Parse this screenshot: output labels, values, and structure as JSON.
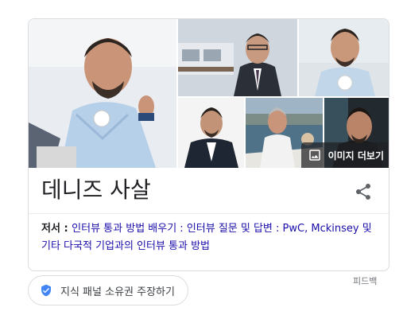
{
  "panel": {
    "title": "데니즈 사살",
    "more_images_label": "이미지 더보기",
    "description": {
      "label": "저서 : ",
      "link_text": "인터뷰 통과 방법 배우기 : 인터뷰 질문 및 답변 : PwC, Mckinsey 및 기타 다국적 기업과의 인터뷰 통과 방법"
    }
  },
  "footer": {
    "claim_label": "지식 패널 소유권 주장하기",
    "feedback_label": "피드백"
  },
  "icons": {
    "share": "share-icon",
    "images": "image-gallery-icon",
    "verified": "verified-shield-icon"
  },
  "colors": {
    "link": "#1a0dab",
    "verified_blue": "#4285f4",
    "border": "#dadce0"
  }
}
